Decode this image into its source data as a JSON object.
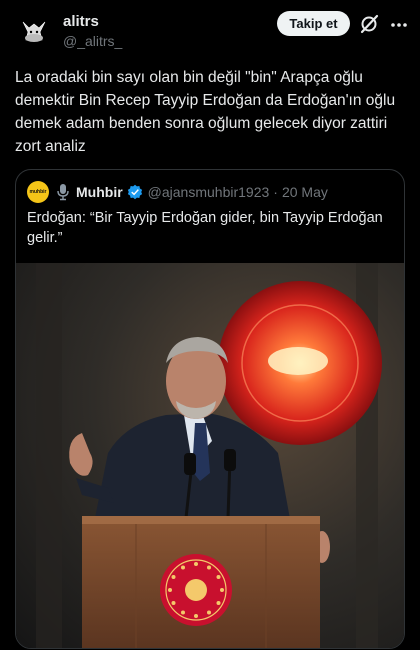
{
  "author": {
    "display_name": "alitrs",
    "handle": "@_alitrs_"
  },
  "follow_label": "Takip et",
  "icons": {
    "grok": "grok-icon",
    "more": "more-icon",
    "verified": "verified-badge-icon",
    "mic": "microphone-icon"
  },
  "tweet_text": "La oradaki bin sayı olan bin değil \"bin\" Arapça oğlu demektir Bin Recep Tayyip Erdoğan da Erdoğan'ın oğlu demek adam benden sonra oğlum gelecek diyor zattiri zort analiz",
  "quote": {
    "avatar_text": "muhbir",
    "name": "Muhbir",
    "handle": "@ajansmuhbir1923",
    "separator": "·",
    "date": "20 May",
    "text": "Erdoğan: “Bir Tayyip Erdoğan gider, bin Tayyip Erdoğan gelir.”"
  },
  "colors": {
    "background": "#000000",
    "verified": "#1d9bf0",
    "emblem_red": "#c8102e"
  }
}
